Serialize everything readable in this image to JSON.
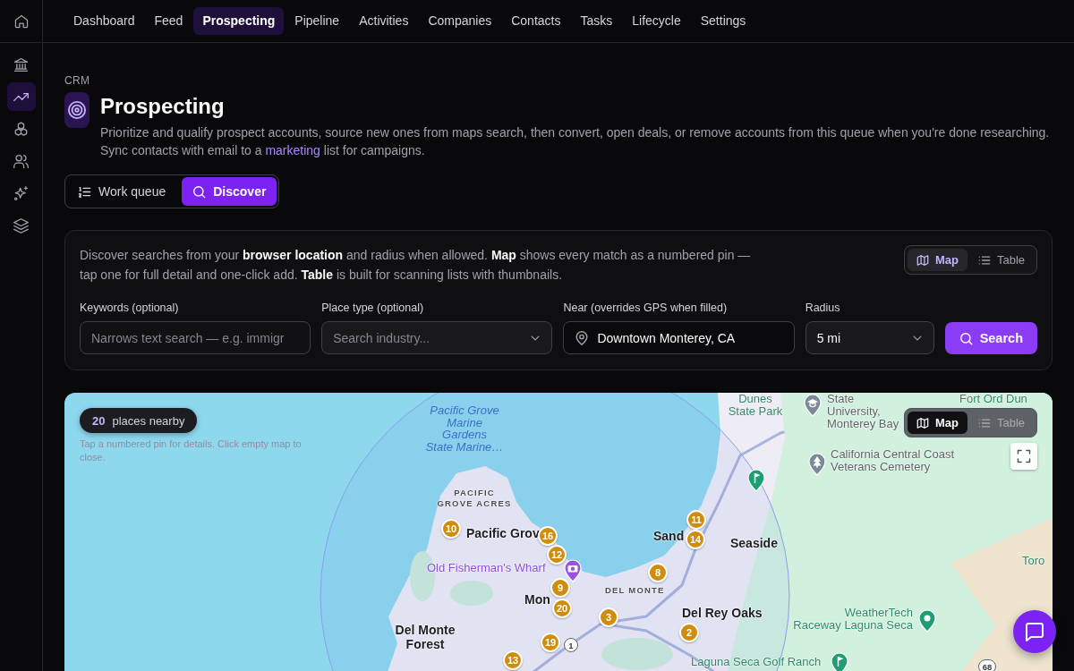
{
  "sidebar": {
    "items": [
      {
        "selected": false
      },
      {
        "selected": true
      },
      {
        "selected": false
      },
      {
        "selected": false
      },
      {
        "selected": false
      },
      {
        "selected": false
      }
    ]
  },
  "nav": {
    "tabs": [
      {
        "label": "Dashboard",
        "selected": false
      },
      {
        "label": "Feed",
        "selected": false
      },
      {
        "label": "Prospecting",
        "selected": true
      },
      {
        "label": "Pipeline",
        "selected": false
      },
      {
        "label": "Activities",
        "selected": false
      },
      {
        "label": "Companies",
        "selected": false
      },
      {
        "label": "Contacts",
        "selected": false
      },
      {
        "label": "Tasks",
        "selected": false
      },
      {
        "label": "Lifecycle",
        "selected": false
      },
      {
        "label": "Settings",
        "selected": false
      }
    ]
  },
  "header": {
    "breadcrumb": "CRM",
    "title": "Prospecting",
    "description": {
      "before": "Prioritize and qualify prospect accounts, source new ones from maps search, then convert, open deals, or remove accounts from this queue when you're done researching. Sync contacts with email to a ",
      "link": "marketing",
      "after": " list for campaigns."
    }
  },
  "mode_tabs": [
    {
      "label": "Work queue",
      "selected": false
    },
    {
      "label": "Discover",
      "selected": true
    }
  ],
  "discover": {
    "intro": "Discover searches from your **browser location** and radius when allowed. **Map** shows every match as a numbered pin — tap one for full detail and one-click add. **Table** is built for scanning lists with thumbnails.",
    "view_toggle": [
      {
        "label": "Map",
        "selected": true
      },
      {
        "label": "Table",
        "selected": false
      }
    ],
    "fields": [
      {
        "kind": "text",
        "label": "Keywords (optional)",
        "placeholder": "Narrows text search — e.g. immigr"
      },
      {
        "kind": "select",
        "label": "Place type (optional)",
        "placeholder": "Search industry..."
      },
      {
        "kind": "location",
        "label": "Near (overrides GPS when filled)",
        "value": "Downtown Monterey, CA"
      },
      {
        "kind": "select",
        "label": "Radius",
        "value": "5 mi"
      }
    ],
    "search_button": "Search"
  },
  "map": {
    "count": "20",
    "count_label": "places nearby",
    "hint": "Tap a numbered pin for details. Click empty map to close.",
    "view_toggle": [
      {
        "label": "Map",
        "selected": true
      },
      {
        "label": "Table",
        "selected": false
      }
    ],
    "labels": [
      {
        "kind": "park",
        "text": "Dunes\nState Park"
      },
      {
        "kind": "place",
        "text": "State\nUniversity,\nMonterey Bay"
      },
      {
        "kind": "park",
        "text": "Fort Ord Dun"
      },
      {
        "kind": "water",
        "text": "Pacific Grove\nMarine\nGardens\nState Marine…"
      },
      {
        "kind": "place",
        "text": "California Central Coast\nVeterans Cemetery"
      },
      {
        "kind": "district",
        "text": "PACIFIC\nGROVE ACRES"
      },
      {
        "kind": "town",
        "text": "Pacific Grov"
      },
      {
        "kind": "town",
        "text": "Sand"
      },
      {
        "kind": "town",
        "text": "Seaside"
      },
      {
        "kind": "park",
        "text": "Toro"
      },
      {
        "kind": "landmark",
        "text": "Old Fisherman's Wharf"
      },
      {
        "kind": "district",
        "text": "DEL MONTE"
      },
      {
        "kind": "town",
        "text": "Mon"
      },
      {
        "kind": "town",
        "text": "Del Rey Oaks"
      },
      {
        "kind": "park",
        "text": "WeatherTech\nRaceway Laguna Seca"
      },
      {
        "kind": "town",
        "text": "Del Monte\nForest"
      },
      {
        "kind": "park",
        "text": "Laguna Seca Golf Ranch"
      }
    ],
    "pins": [
      "11",
      "10",
      "16",
      "14",
      "12",
      "8",
      "9",
      "20",
      "3",
      "2",
      "19",
      "13"
    ],
    "road_shields": [
      "1",
      "68"
    ]
  }
}
